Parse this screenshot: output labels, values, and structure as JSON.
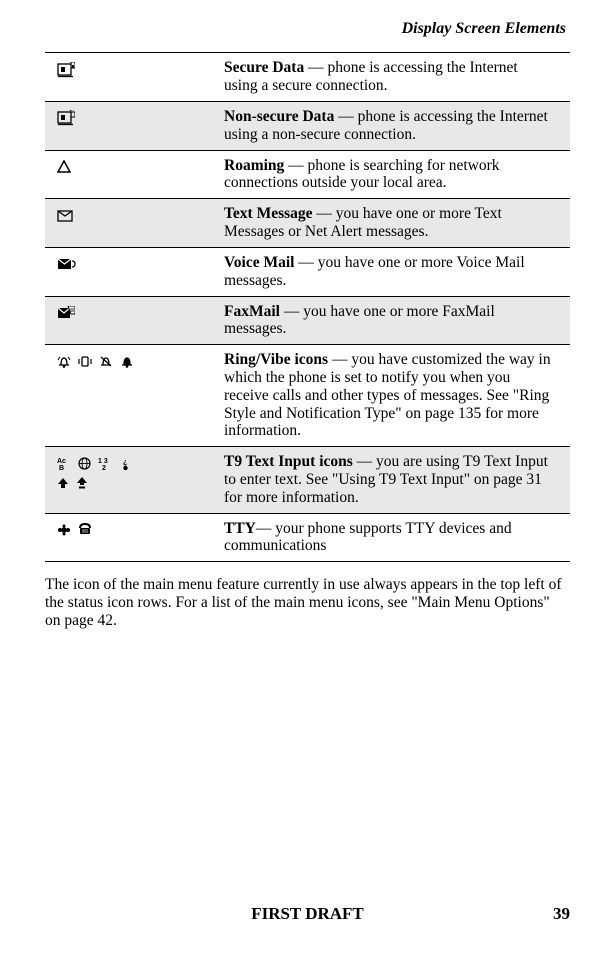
{
  "header": {
    "running_head": "Display Screen Elements"
  },
  "rows": [
    {
      "title": "Secure Data",
      "sep": " — ",
      "desc": "phone is accessing the Internet using a secure connection."
    },
    {
      "title": "Non-secure Data",
      "sep": " — ",
      "desc": "phone is accessing the Internet using a non-secure connection."
    },
    {
      "title": "Roaming",
      "sep": " — ",
      "desc": "phone is searching for network connections outside your local area."
    },
    {
      "title": "Text Message",
      "sep": " — ",
      "desc": "you have one or more Text Messages or Net Alert messages."
    },
    {
      "title": "Voice Mail",
      "sep": " — ",
      "desc": "you have one or more Voice Mail messages."
    },
    {
      "title": "FaxMail",
      "sep": " — ",
      "desc": "you have one or more FaxMail messages."
    },
    {
      "title": "Ring/Vibe icons",
      "sep": " — ",
      "desc": "you have customized the way in which the phone is set to notify you when you receive calls and other types of messages. See \"Ring Style and Notification Type\" on page 135 for more information."
    },
    {
      "title": "T9 Text Input icons",
      "sep": " — ",
      "desc": "you are using T9 Text Input to enter text. See \"Using T9 Text Input\" on page 31 for more information."
    },
    {
      "title": "TTY",
      "sep": "— ",
      "desc": "your phone supports TTY devices and communications"
    }
  ],
  "body_para": "The icon of the main menu feature currently in use always appears in the top left of the status icon rows. For a list of the main menu icons, see \"Main Menu Options\" on page 42.",
  "footer": {
    "draft": "FIRST DRAFT",
    "page_num": "39"
  }
}
